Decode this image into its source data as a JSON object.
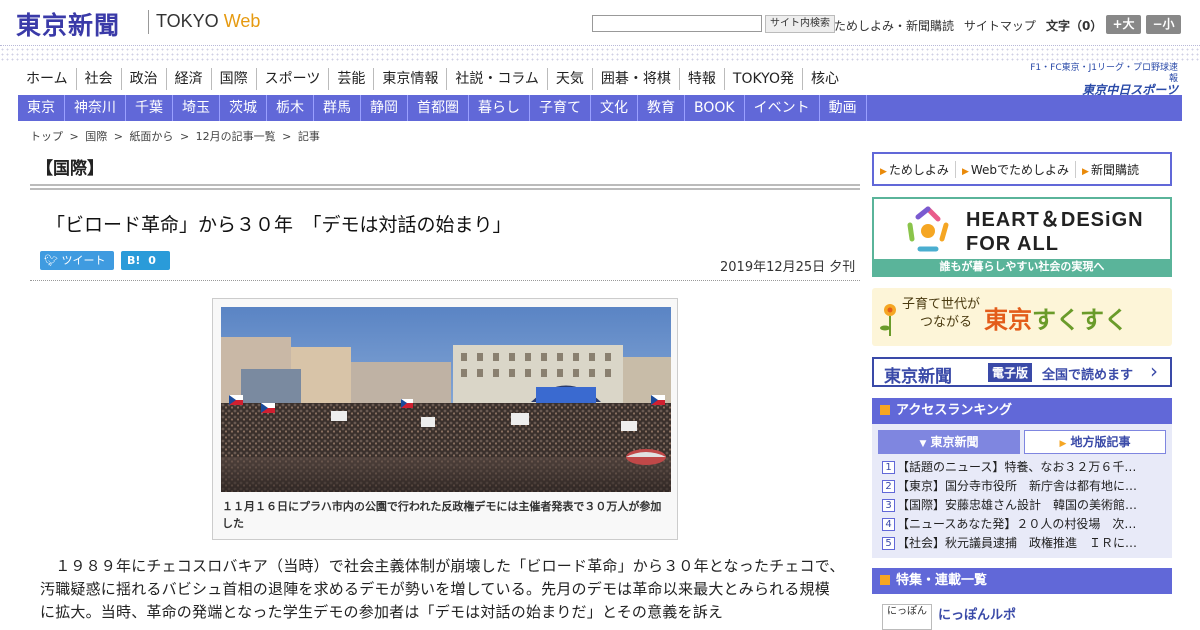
{
  "header": {
    "logo_jp": "東京新聞",
    "logo_en": "TOKYO",
    "logo_en_web": "Web",
    "search_button": "サイト内検索",
    "links": [
      "ためしよみ・新聞購読",
      "サイトマップ"
    ],
    "font_size_label": "文字（0）",
    "font_bigger": "+大",
    "font_smaller": "−小"
  },
  "nav_main": [
    "ホーム",
    "社会",
    "政治",
    "経済",
    "国際",
    "スポーツ",
    "芸能",
    "東京情報",
    "社説・コラム",
    "天気",
    "囲碁・将棋",
    "特報",
    "TOKYO発",
    "核心"
  ],
  "f1_banner": {
    "line1": "F1・FC東京・J1リーグ・プロ野球速報",
    "line2": "東京中日スポーツ"
  },
  "nav_region": [
    "東京",
    "神奈川",
    "千葉",
    "埼玉",
    "茨城",
    "栃木",
    "群馬",
    "静岡",
    "首都圏",
    "暮らし",
    "子育て",
    "文化",
    "教育",
    "BOOK",
    "イベント",
    "動画"
  ],
  "breadcrumb": [
    "トップ",
    ">",
    "国際",
    ">",
    "紙面から",
    ">",
    "12月の記事一覧",
    ">",
    "記事"
  ],
  "section_title": "【国際】",
  "article": {
    "title": "「ビロード革命」から３０年　「デモは対話の始まり」",
    "tweet_label": "ツイート",
    "hatena_label": "B!",
    "hatena_count": "0",
    "date": "2019年12月25日 夕刊",
    "caption": "１１月１６日にプラハ市内の公園で行われた反政権デモには主催者発表で３０万人が参加した",
    "body": "　１９８９年にチェコスロバキア（当時）で社会主義体制が崩壊した「ビロード革命」から３０年となったチェコで、汚職疑惑に揺れるバビシュ首相の退陣を求めるデモが勢いを増している。先月のデモは革命以来最大とみられる規模に拡大。当時、革命の発端となった学生デモの参加者は「デモは対話の始まりだ」とその意義を訴え"
  },
  "sidebar": {
    "buttons": [
      "ためしよみ",
      "Webでためしよみ",
      "新聞購読"
    ],
    "heart_design": {
      "line1": "HEART＆DESiGN",
      "line2": "FOR ALL",
      "sub": "誰もが暮らしやすい社会の実現へ"
    },
    "sukusuku": {
      "left1": "子育て世代が",
      "left2": "つながる",
      "brand_tokyo": "東京",
      "brand_suku": "すくすく"
    },
    "epaper": {
      "logo": "東京新聞",
      "tag": "電子版",
      "text": "全国で読めます"
    },
    "ranking": {
      "title": "アクセスランキング",
      "tab_active": "東京新聞",
      "tab_inactive": "地方版記事",
      "items": [
        {
          "num": "1",
          "text": "【話題のニュース】特養、なお３２万６千…"
        },
        {
          "num": "2",
          "text": "【東京】国分寺市役所　新庁舎は都有地に…"
        },
        {
          "num": "3",
          "text": "【国際】安藤忠雄さん設計　韓国の美術館…"
        },
        {
          "num": "4",
          "text": "【ニュースあなた発】２０人の村役場　次…"
        },
        {
          "num": "5",
          "text": "【社会】秋元議員逮捕　政権推進　ＩＲに…"
        }
      ]
    },
    "special": {
      "title": "特集・連載一覧",
      "thumb_text": "にっぽん",
      "item_title": "にっぽんルポ"
    }
  },
  "colors": {
    "brand_blue": "#3a3aa8",
    "nav_blue": "#6168d8",
    "accent_orange": "#e69a10",
    "hd_green": "#5ab49a"
  }
}
